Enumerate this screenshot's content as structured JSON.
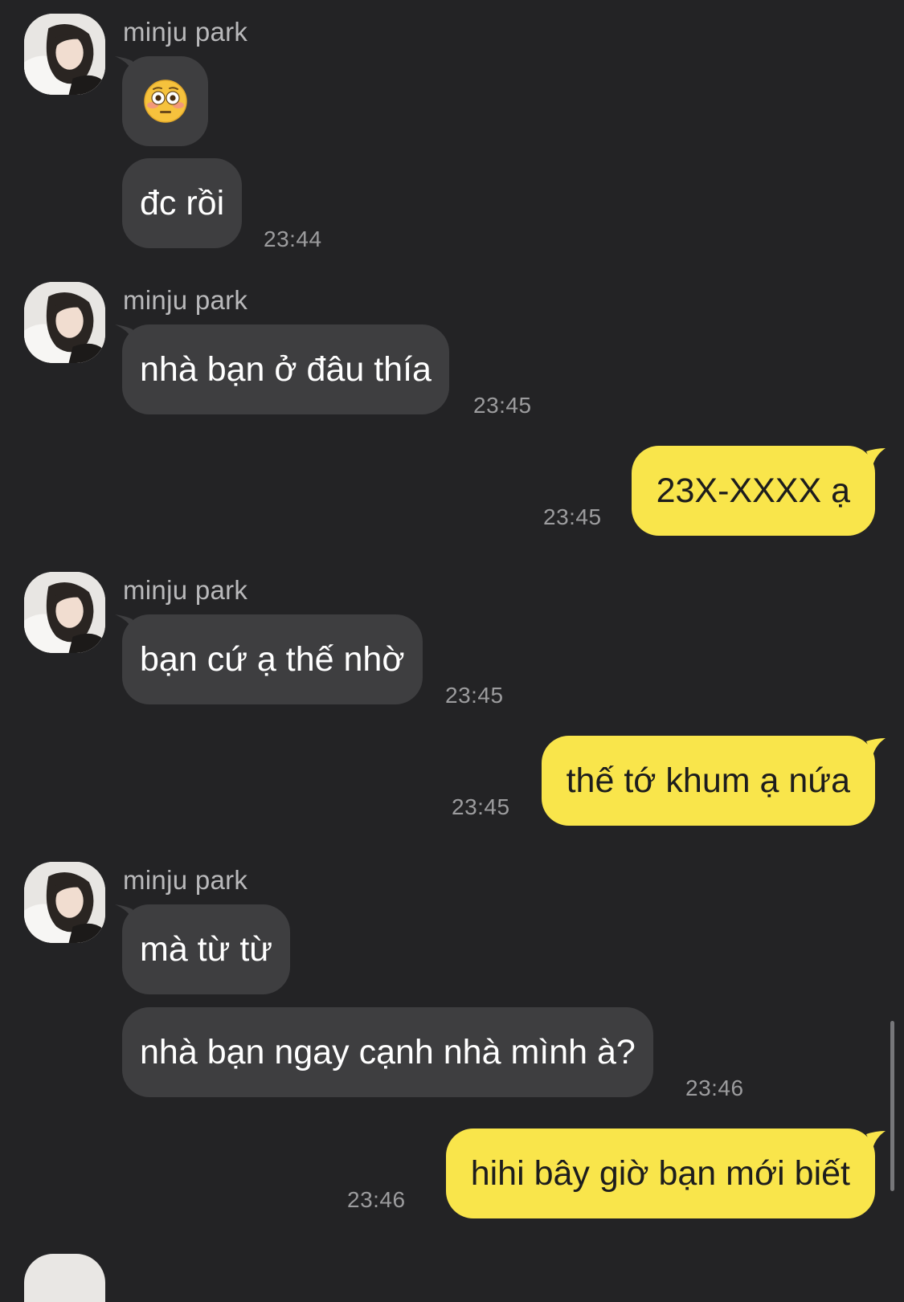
{
  "sender_name": "minju park",
  "emoji_flushed": "flushed-face",
  "messages": {
    "m1": "đc rồi",
    "m2": "nhà bạn ở đâu thía",
    "m3": "23X-XXXX ạ",
    "m4": "bạn cứ ạ thế nhờ",
    "m5": "thế tớ khum ạ nứa",
    "m6": "mà từ từ",
    "m7": "nhà bạn ngay cạnh nhà mình à?",
    "m8": "hihi bây giờ bạn mới biết"
  },
  "times": {
    "t1": "23:44",
    "t2": "23:45",
    "t3": "23:45",
    "t4": "23:45",
    "t5": "23:45",
    "t6": "23:46",
    "t7": "23:46"
  },
  "colors": {
    "background": "#232325",
    "incoming_bubble": "#3e3e40",
    "outgoing_bubble": "#f9e54b"
  }
}
